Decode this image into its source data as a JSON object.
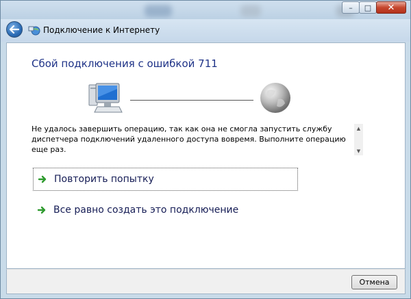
{
  "window": {
    "nav_title": "Подключение к Интернету"
  },
  "dialog": {
    "heading": "Сбой подключения с ошибкой 711",
    "message": "Не удалось завершить операцию, так как она не смогла запустить службу диспетчера подключений удаленного доступа вовремя. Выполните операцию еще раз.",
    "tasks": [
      {
        "label": "Повторить попытку",
        "icon": "green-arrow-icon",
        "selected": true
      },
      {
        "label": "Все равно создать это подключение",
        "icon": "green-arrow-icon",
        "selected": false
      }
    ],
    "cancel_label": "Отмена"
  },
  "colors": {
    "heading": "#1e3287",
    "task_text": "#151c55",
    "arrow": "#2e9a2e"
  }
}
